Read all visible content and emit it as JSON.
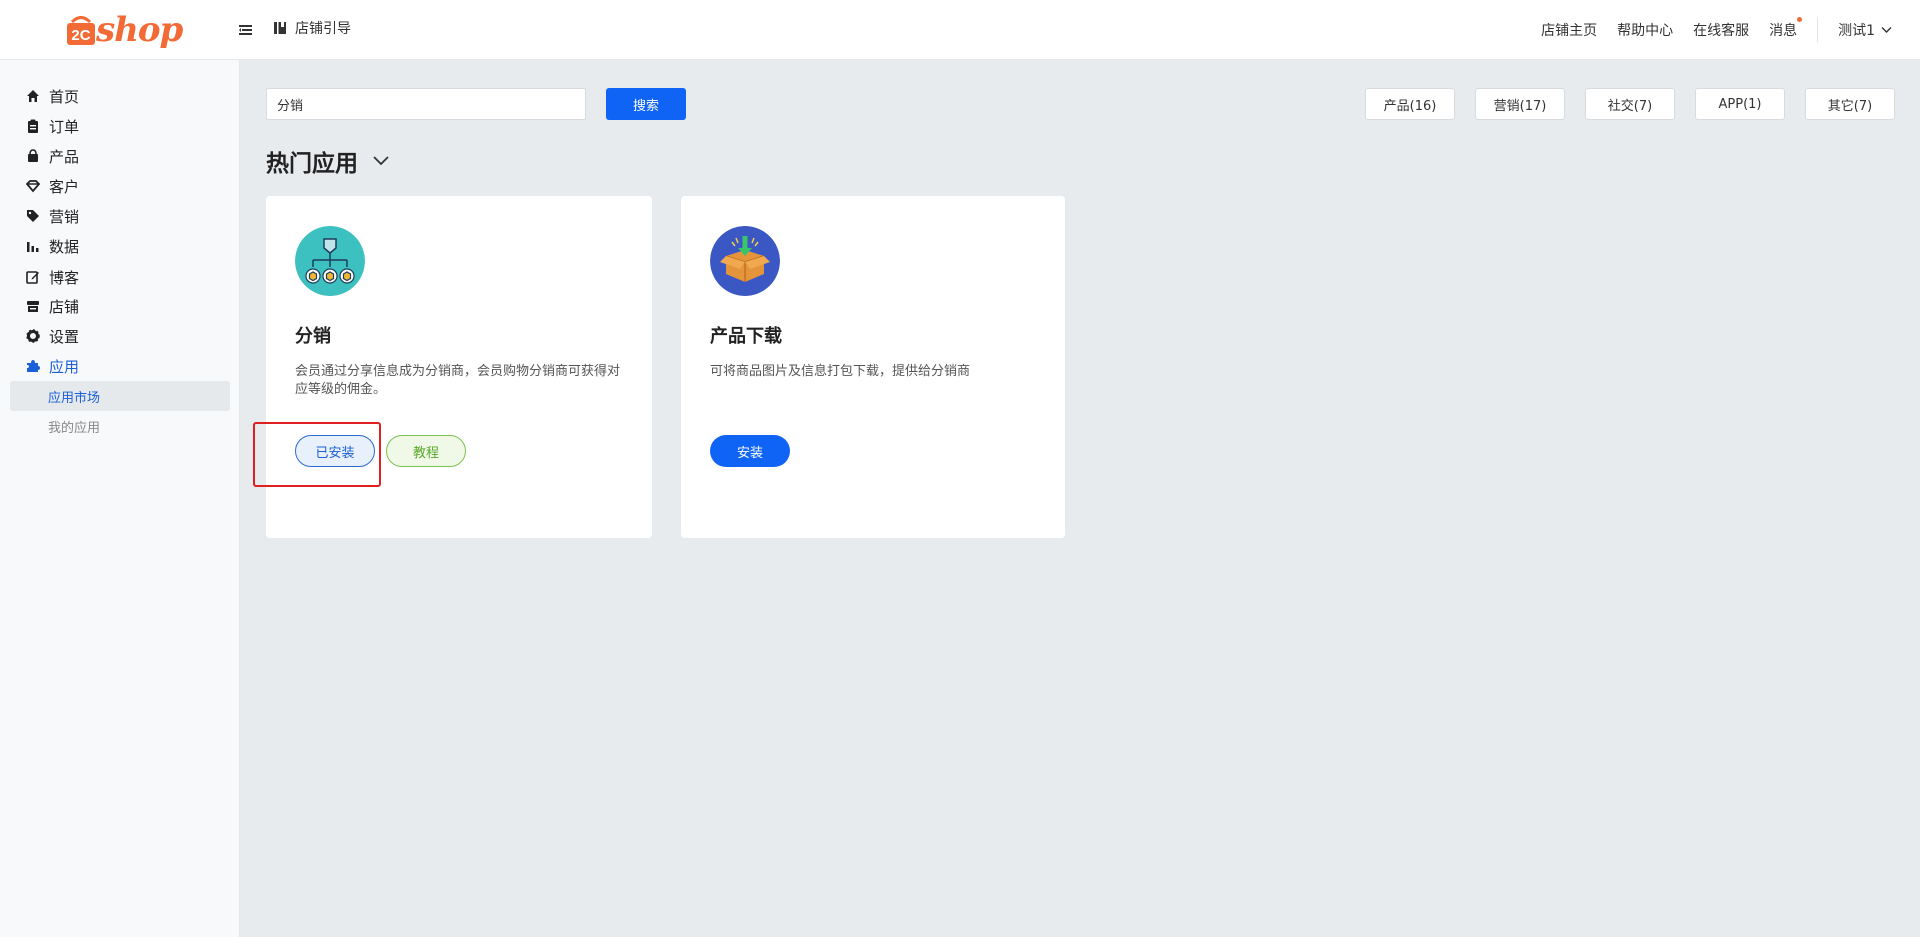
{
  "header": {
    "logo_text": "2Cshop",
    "guide_label": "店铺引导",
    "nav": [
      "店铺主页",
      "帮助中心",
      "在线客服",
      "消息"
    ],
    "user_name": "测试1",
    "brand_color": "#f26a35"
  },
  "sidebar": {
    "items": [
      {
        "label": "首页",
        "icon": "home-icon"
      },
      {
        "label": "订单",
        "icon": "clipboard-icon"
      },
      {
        "label": "产品",
        "icon": "bag-icon"
      },
      {
        "label": "客户",
        "icon": "diamond-icon"
      },
      {
        "label": "营销",
        "icon": "tag-icon"
      },
      {
        "label": "数据",
        "icon": "bar-chart-icon"
      },
      {
        "label": "博客",
        "icon": "edit-icon"
      },
      {
        "label": "店铺",
        "icon": "store-icon"
      },
      {
        "label": "设置",
        "icon": "gear-icon"
      },
      {
        "label": "应用",
        "icon": "puzzle-icon"
      }
    ],
    "sub_items": [
      "应用市场",
      "我的应用"
    ],
    "active_item": "应用",
    "active_sub_item": "应用市场"
  },
  "search": {
    "value": "分销",
    "button_label": "搜索"
  },
  "categories": [
    "产品(16)",
    "营销(17)",
    "社交(7)",
    "APP(1)",
    "其它(7)"
  ],
  "section_title": "热门应用",
  "apps": [
    {
      "name": "分销",
      "description": "会员通过分享信息成为分销商，会员购物分销商可获得对应等级的佣金。",
      "icon": "distribution-network-icon",
      "installed_label": "已安装",
      "tutorial_label": "教程"
    },
    {
      "name": "产品下载",
      "description": "可将商品图片及信息打包下载，提供给分销商",
      "icon": "box-download-icon",
      "install_label": "安装"
    }
  ],
  "colors": {
    "primary": "#1064f5",
    "active_text": "#1a5fd8",
    "tutorial_green": "#58a82a",
    "highlight_red": "#e02020"
  }
}
